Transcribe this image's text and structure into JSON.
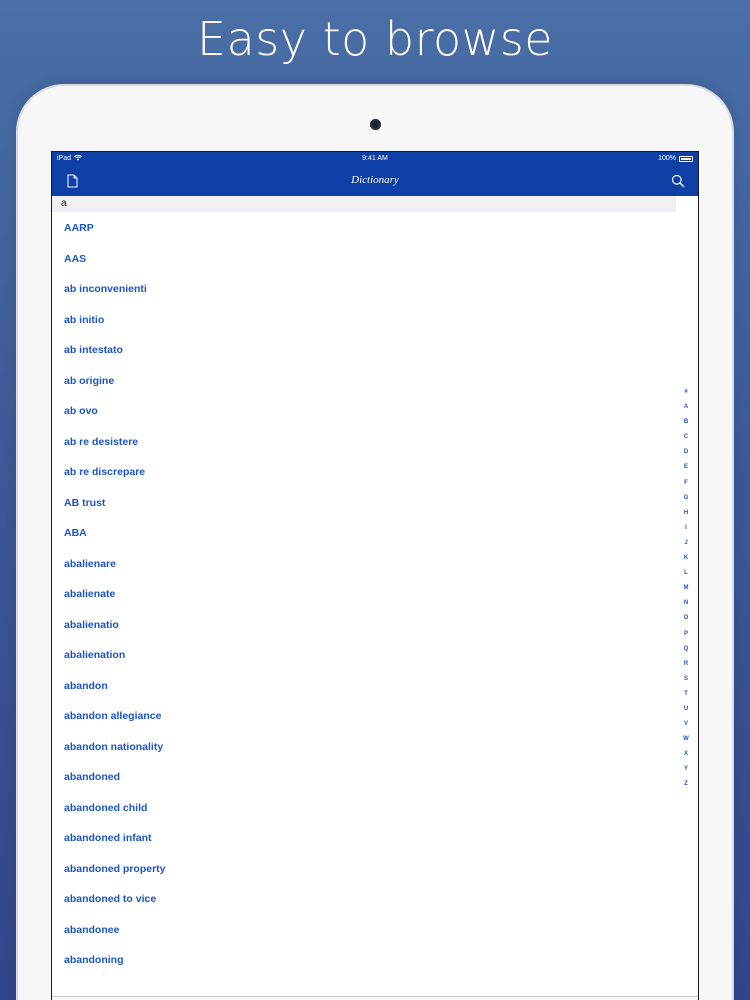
{
  "headline": "Easy to browse",
  "status_bar": {
    "carrier": "iPad",
    "time": "9:41 AM",
    "battery": "100%"
  },
  "nav": {
    "title": "Dictionary",
    "left_icon": "document-icon",
    "right_icon": "search-icon"
  },
  "section_header": "a",
  "entries": [
    "AARP",
    "AAS",
    "ab inconvenienti",
    "ab initio",
    "ab intestato",
    "ab origine",
    "ab ovo",
    "ab re desistere",
    "ab re discrepare",
    "AB trust",
    "ABA",
    "abalienare",
    "abalienate",
    "abalienatio",
    "abalienation",
    "abandon",
    "abandon allegiance",
    "abandon nationality",
    "abandoned",
    "abandoned child",
    "abandoned infant",
    "abandoned property",
    "abandoned to vice",
    "abandonee",
    "abandoning"
  ],
  "index_letters": [
    "#",
    "A",
    "B",
    "C",
    "D",
    "E",
    "F",
    "G",
    "H",
    "I",
    "J",
    "K",
    "L",
    "M",
    "N",
    "O",
    "P",
    "Q",
    "R",
    "S",
    "T",
    "U",
    "V",
    "W",
    "X",
    "Y",
    "Z"
  ],
  "tabs": [
    {
      "icon": "dictionary-icon",
      "active": true
    },
    {
      "icon": "list-icon",
      "active": false
    },
    {
      "icon": "star-icon",
      "active": false
    },
    {
      "icon": "book-icon",
      "active": false
    },
    {
      "icon": "menu-icon",
      "active": false
    }
  ],
  "colors": {
    "accent": "#0e3fa6",
    "link": "#1d54c4",
    "background": "#3c5a95"
  }
}
